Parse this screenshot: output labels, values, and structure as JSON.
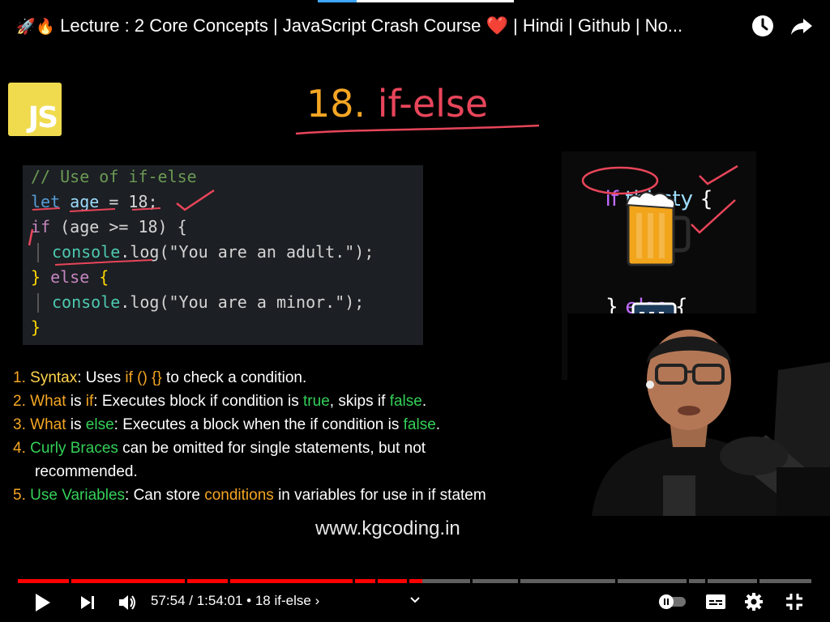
{
  "header": {
    "title_emoji_1": "🚀",
    "title_emoji_2": "🔥",
    "title": "Lecture : 2 Core Concepts | JavaScript Crash Course ❤️ | Hindi | Github | No...",
    "watch_later_icon": "clock-icon",
    "share_icon": "share-arrow-icon"
  },
  "slide": {
    "logo_text": "JS",
    "title_number": "18.",
    "title_keyword": "if-else",
    "code": {
      "line1": "// Use of if-else",
      "line2_kw": "let",
      "line2_var": "age",
      "line2_rest": " = 18;",
      "line3_kw": "if",
      "line3_rest": " (age >= 18) {",
      "line4_obj": "console",
      "line4_rest": ".log(\"You are an adult.\");",
      "line5_a": "} ",
      "line5_kw": "else",
      "line5_b": " {",
      "line6_obj": "console",
      "line6_rest": ".log(\"You are a minor.\");",
      "line7": "}"
    },
    "analogy": {
      "if_kw": "if",
      "condition": "thirsty",
      "open_brace": "{",
      "else_close": "}",
      "else_kw": "else",
      "else_open": "{",
      "close_brace": "}"
    },
    "points": [
      {
        "num": "1.",
        "label": "Syntax",
        "text_a": ": Uses ",
        "code": "if () {}",
        "text_b": " to check a condition."
      },
      {
        "num": "2.",
        "label": "What",
        "text_a": " is ",
        "code": "if",
        "text_b": ": Executes block if condition is ",
        "true": "true",
        "text_c": ", skips if ",
        "false": "false",
        "text_d": "."
      },
      {
        "num": "3.",
        "label": "What",
        "text_a": " is ",
        "code": "else",
        "text_b": ": Executes a block when the if condition is ",
        "false": "false",
        "text_c": "."
      },
      {
        "num": "4.",
        "label": "Curly Braces",
        "text_a": " can be omitted for single statements, but not",
        "text_b": "recommended."
      },
      {
        "num": "5.",
        "label": "Use Variables",
        "text_a": ": Can store ",
        "code": "conditions",
        "text_b": " in variables for use in if statem"
      }
    ],
    "website": "www.kgcoding.in"
  },
  "player": {
    "current_time": "57:54",
    "separator": " / ",
    "duration": "1:54:01",
    "chapter": " • 18 if-else",
    "chapter_chevron": "›",
    "progress_fraction": 0.5078,
    "icons": [
      "play-icon",
      "next-icon",
      "volume-icon",
      "expand-chapters-icon",
      "autoplay-toggle-icon",
      "subtitles-icon",
      "settings-gear-icon",
      "fullscreen-icon"
    ]
  },
  "colors": {
    "played": "#ff0000",
    "unplayed": "#5f5f5f",
    "accent_orange": "#f5a623",
    "accent_green": "#34d058",
    "js_yellow": "#f0db4f"
  }
}
